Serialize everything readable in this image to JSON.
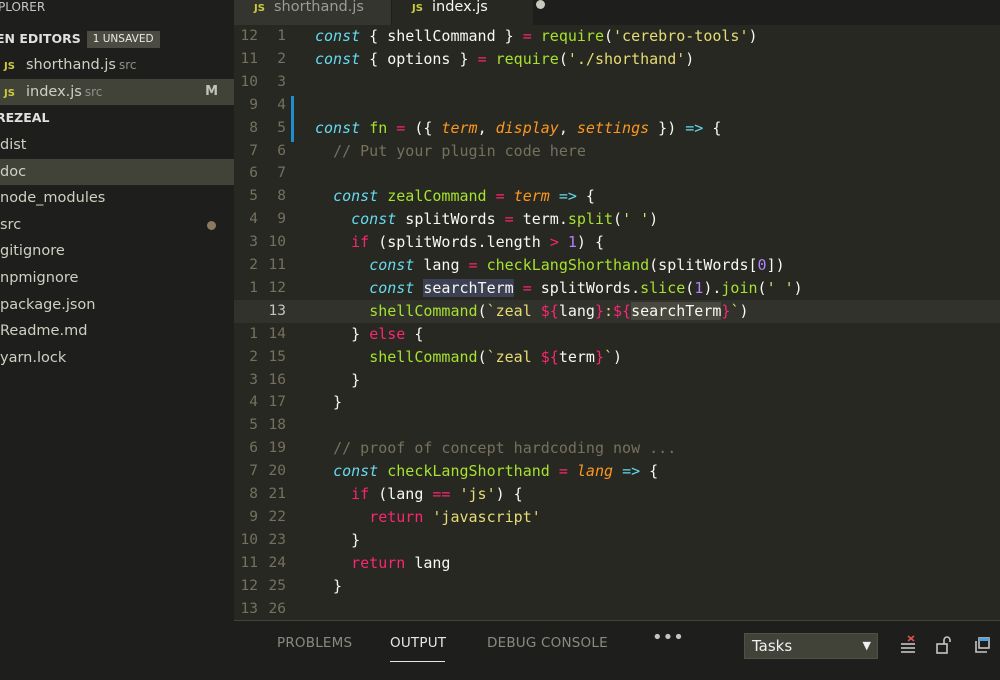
{
  "sidebar": {
    "title": "PLORER",
    "open_editors_label": "EN EDITORS",
    "unsaved_badge": "1 UNSAVED",
    "open_editors": [
      {
        "name": "shorthand.js",
        "path": "src",
        "badge": "JS",
        "marker": "",
        "active": false
      },
      {
        "name": "index.js",
        "path": "src",
        "badge": "JS",
        "marker": "M",
        "active": true
      }
    ],
    "project_label": "REZEAL",
    "files": [
      {
        "name": "dist",
        "dot": false,
        "active": false
      },
      {
        "name": "doc",
        "dot": false,
        "active": true
      },
      {
        "name": "node_modules",
        "dot": false,
        "active": false
      },
      {
        "name": "src",
        "dot": true,
        "active": false
      },
      {
        "name": "gitignore",
        "dot": false,
        "active": false
      },
      {
        "name": "npmignore",
        "dot": false,
        "active": false
      },
      {
        "name": "package.json",
        "dot": false,
        "active": false
      },
      {
        "name": "Readme.md",
        "dot": false,
        "active": false
      },
      {
        "name": "yarn.lock",
        "dot": false,
        "active": false
      }
    ]
  },
  "tabs": [
    {
      "name": "shorthand.js",
      "badge": "JS",
      "active": false,
      "dirty": false
    },
    {
      "name": "index.js",
      "badge": "JS",
      "active": true,
      "dirty": true
    }
  ],
  "editor": {
    "current_line": 13,
    "lines": [
      {
        "rel": "12",
        "abs": "1",
        "tokens": [
          [
            "kw",
            "const"
          ],
          [
            "pl",
            " { shellCommand } "
          ],
          [
            "op",
            "="
          ],
          [
            "pl",
            " "
          ],
          [
            "fn",
            "require"
          ],
          [
            "pl",
            "("
          ],
          [
            "str",
            "'cerebro-tools'"
          ],
          [
            "pl",
            ")"
          ]
        ]
      },
      {
        "rel": "11",
        "abs": "2",
        "tokens": [
          [
            "kw",
            "const"
          ],
          [
            "pl",
            " { options } "
          ],
          [
            "op",
            "="
          ],
          [
            "pl",
            " "
          ],
          [
            "fn",
            "require"
          ],
          [
            "pl",
            "("
          ],
          [
            "str",
            "'./shorthand'"
          ],
          [
            "pl",
            ")"
          ]
        ]
      },
      {
        "rel": "10",
        "abs": "3",
        "tokens": []
      },
      {
        "rel": "9",
        "abs": "4",
        "tokens": []
      },
      {
        "rel": "8",
        "abs": "5",
        "tokens": [
          [
            "kw",
            "const"
          ],
          [
            "pl",
            " "
          ],
          [
            "fn",
            "fn"
          ],
          [
            "pl",
            " "
          ],
          [
            "op",
            "="
          ],
          [
            "pl",
            " ({ "
          ],
          [
            "param",
            "term"
          ],
          [
            "pl",
            ", "
          ],
          [
            "param",
            "display"
          ],
          [
            "pl",
            ", "
          ],
          [
            "param",
            "settings"
          ],
          [
            "pl",
            " }) "
          ],
          [
            "kw",
            "=>"
          ],
          [
            "pl",
            " {"
          ]
        ]
      },
      {
        "rel": "7",
        "abs": "6",
        "tokens": [
          [
            "pl",
            "  "
          ],
          [
            "cm",
            "// Put your plugin code here"
          ]
        ]
      },
      {
        "rel": "6",
        "abs": "7",
        "tokens": []
      },
      {
        "rel": "5",
        "abs": "8",
        "tokens": [
          [
            "pl",
            "  "
          ],
          [
            "kw",
            "const"
          ],
          [
            "pl",
            " "
          ],
          [
            "fn",
            "zealCommand"
          ],
          [
            "pl",
            " "
          ],
          [
            "op",
            "="
          ],
          [
            "pl",
            " "
          ],
          [
            "param",
            "term"
          ],
          [
            "pl",
            " "
          ],
          [
            "kw",
            "=>"
          ],
          [
            "pl",
            " {"
          ]
        ]
      },
      {
        "rel": "4",
        "abs": "9",
        "tokens": [
          [
            "pl",
            "    "
          ],
          [
            "kw",
            "const"
          ],
          [
            "pl",
            " splitWords "
          ],
          [
            "op",
            "="
          ],
          [
            "pl",
            " term."
          ],
          [
            "fn",
            "split"
          ],
          [
            "pl",
            "("
          ],
          [
            "str",
            "' '"
          ],
          [
            "pl",
            ")"
          ]
        ]
      },
      {
        "rel": "3",
        "abs": "10",
        "tokens": [
          [
            "pl",
            "    "
          ],
          [
            "kw2",
            "if"
          ],
          [
            "pl",
            " (splitWords.length "
          ],
          [
            "op",
            ">"
          ],
          [
            "pl",
            " "
          ],
          [
            "num",
            "1"
          ],
          [
            "pl",
            ") {"
          ]
        ]
      },
      {
        "rel": "2",
        "abs": "11",
        "tokens": [
          [
            "pl",
            "      "
          ],
          [
            "kw",
            "const"
          ],
          [
            "pl",
            " lang "
          ],
          [
            "op",
            "="
          ],
          [
            "pl",
            " "
          ],
          [
            "fn",
            "checkLangShorthand"
          ],
          [
            "pl",
            "(splitWords["
          ],
          [
            "num",
            "0"
          ],
          [
            "pl",
            "])"
          ]
        ]
      },
      {
        "rel": "1",
        "abs": "12",
        "tokens": [
          [
            "pl",
            "      "
          ],
          [
            "kw",
            "const"
          ],
          [
            "pl",
            " "
          ],
          [
            "sel",
            "searchTerm"
          ],
          [
            "pl",
            " "
          ],
          [
            "op",
            "="
          ],
          [
            "pl",
            " splitWords."
          ],
          [
            "fn",
            "slice"
          ],
          [
            "pl",
            "("
          ],
          [
            "num",
            "1"
          ],
          [
            "pl",
            ")."
          ],
          [
            "fn",
            "join"
          ],
          [
            "pl",
            "("
          ],
          [
            "str",
            "' '"
          ],
          [
            "pl",
            ")"
          ]
        ]
      },
      {
        "rel": "",
        "abs": "13",
        "tokens": [
          [
            "pl",
            "      "
          ],
          [
            "fn",
            "shellCommand"
          ],
          [
            "pl",
            "("
          ],
          [
            "str",
            "`zeal "
          ],
          [
            "kw2",
            "${"
          ],
          [
            "pl",
            "lang"
          ],
          [
            "kw2",
            "}"
          ],
          [
            "str",
            ":"
          ],
          [
            "kw2",
            "${"
          ],
          [
            "hl",
            "searchTerm"
          ],
          [
            "kw2",
            "}"
          ],
          [
            "str",
            "`"
          ],
          [
            "pl",
            ")"
          ]
        ]
      },
      {
        "rel": "1",
        "abs": "14",
        "tokens": [
          [
            "pl",
            "    } "
          ],
          [
            "kw2",
            "else"
          ],
          [
            "pl",
            " {"
          ]
        ]
      },
      {
        "rel": "2",
        "abs": "15",
        "tokens": [
          [
            "pl",
            "      "
          ],
          [
            "fn",
            "shellCommand"
          ],
          [
            "pl",
            "("
          ],
          [
            "str",
            "`zeal "
          ],
          [
            "kw2",
            "${"
          ],
          [
            "pl",
            "term"
          ],
          [
            "kw2",
            "}"
          ],
          [
            "str",
            "`"
          ],
          [
            "pl",
            ")"
          ]
        ]
      },
      {
        "rel": "3",
        "abs": "16",
        "tokens": [
          [
            "pl",
            "    }"
          ]
        ]
      },
      {
        "rel": "4",
        "abs": "17",
        "tokens": [
          [
            "pl",
            "  }"
          ]
        ]
      },
      {
        "rel": "5",
        "abs": "18",
        "tokens": []
      },
      {
        "rel": "6",
        "abs": "19",
        "tokens": [
          [
            "pl",
            "  "
          ],
          [
            "cm",
            "// proof of concept hardcoding now ..."
          ]
        ]
      },
      {
        "rel": "7",
        "abs": "20",
        "tokens": [
          [
            "pl",
            "  "
          ],
          [
            "kw",
            "const"
          ],
          [
            "pl",
            " "
          ],
          [
            "fn",
            "checkLangShorthand"
          ],
          [
            "pl",
            " "
          ],
          [
            "op",
            "="
          ],
          [
            "pl",
            " "
          ],
          [
            "param",
            "lang"
          ],
          [
            "pl",
            " "
          ],
          [
            "kw",
            "=>"
          ],
          [
            "pl",
            " {"
          ]
        ]
      },
      {
        "rel": "8",
        "abs": "21",
        "tokens": [
          [
            "pl",
            "    "
          ],
          [
            "kw2",
            "if"
          ],
          [
            "pl",
            " (lang "
          ],
          [
            "op",
            "=="
          ],
          [
            "pl",
            " "
          ],
          [
            "str",
            "'js'"
          ],
          [
            "pl",
            ") {"
          ]
        ]
      },
      {
        "rel": "9",
        "abs": "22",
        "tokens": [
          [
            "pl",
            "      "
          ],
          [
            "kw2",
            "return"
          ],
          [
            "pl",
            " "
          ],
          [
            "str",
            "'javascript'"
          ]
        ]
      },
      {
        "rel": "10",
        "abs": "23",
        "tokens": [
          [
            "pl",
            "    }"
          ]
        ]
      },
      {
        "rel": "11",
        "abs": "24",
        "tokens": [
          [
            "pl",
            "    "
          ],
          [
            "kw2",
            "return"
          ],
          [
            "pl",
            " lang"
          ]
        ]
      },
      {
        "rel": "12",
        "abs": "25",
        "tokens": [
          [
            "pl",
            "  }"
          ]
        ]
      },
      {
        "rel": "13",
        "abs": "26",
        "tokens": [
          [
            "pl",
            "  "
          ]
        ]
      }
    ]
  },
  "panel": {
    "tabs": [
      {
        "label": "PROBLEMS",
        "active": false
      },
      {
        "label": "OUTPUT",
        "active": true
      },
      {
        "label": "DEBUG CONSOLE",
        "active": false
      }
    ],
    "more_label": "•••",
    "select_value": "Tasks",
    "icons": [
      "clear-output-icon",
      "lock-scroll-icon",
      "new-panel-icon"
    ]
  }
}
